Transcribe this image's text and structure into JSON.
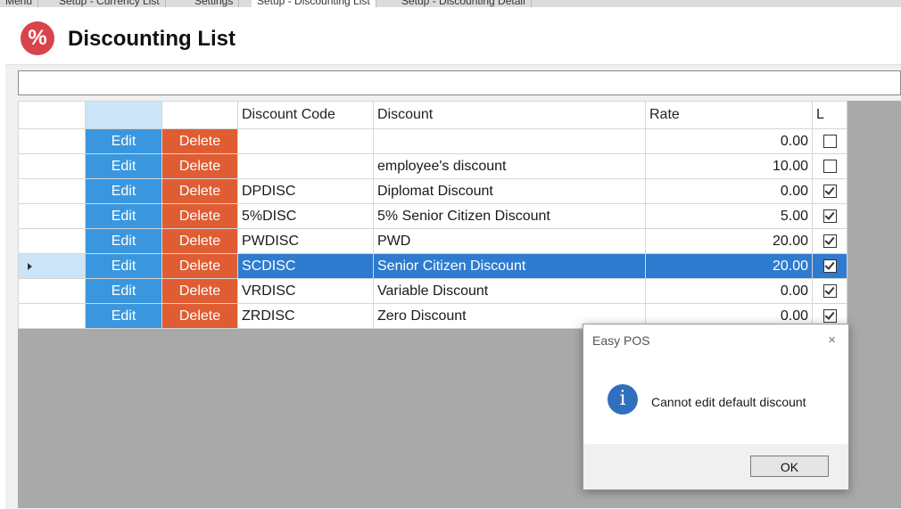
{
  "tabs": [
    "Menu",
    "Setup - Currency List",
    "Settings",
    "Setup - Discounting List",
    "Setup - Discounting Detail"
  ],
  "header": {
    "title": "Discounting List",
    "icon_glyph": "%",
    "icon": "percent-icon"
  },
  "search": {
    "value": ""
  },
  "grid": {
    "columns": [
      "",
      "",
      "",
      "Discount Code",
      "Discount",
      "Rate",
      "L"
    ],
    "edit_label": "Edit",
    "delete_label": "Delete",
    "rows": [
      {
        "code": "",
        "discount": "",
        "rate": "0.00",
        "locked": false,
        "selected": false
      },
      {
        "code": "",
        "discount": "employee's discount",
        "rate": "10.00",
        "locked": false,
        "selected": false
      },
      {
        "code": "DPDISC",
        "discount": "Diplomat Discount",
        "rate": "0.00",
        "locked": true,
        "selected": false
      },
      {
        "code": "5%DISC",
        "discount": "5% Senior Citizen Discount",
        "rate": "5.00",
        "locked": true,
        "selected": false
      },
      {
        "code": "PWDISC",
        "discount": "PWD",
        "rate": "20.00",
        "locked": true,
        "selected": false
      },
      {
        "code": "SCDISC",
        "discount": "Senior Citizen Discount",
        "rate": "20.00",
        "locked": true,
        "selected": true
      },
      {
        "code": "VRDISC",
        "discount": "Variable Discount",
        "rate": "0.00",
        "locked": true,
        "selected": false
      },
      {
        "code": "ZRDISC",
        "discount": "Zero Discount",
        "rate": "0.00",
        "locked": true,
        "selected": false
      }
    ]
  },
  "dialog": {
    "title": "Easy POS",
    "message": "Cannot edit default discount",
    "ok_label": "OK",
    "close_glyph": "×",
    "info_glyph": "i"
  },
  "colors": {
    "edit": "#3a97df",
    "delete": "#e05d33",
    "selected_row": "#2e7bcf",
    "title_icon": "#d9434c"
  }
}
